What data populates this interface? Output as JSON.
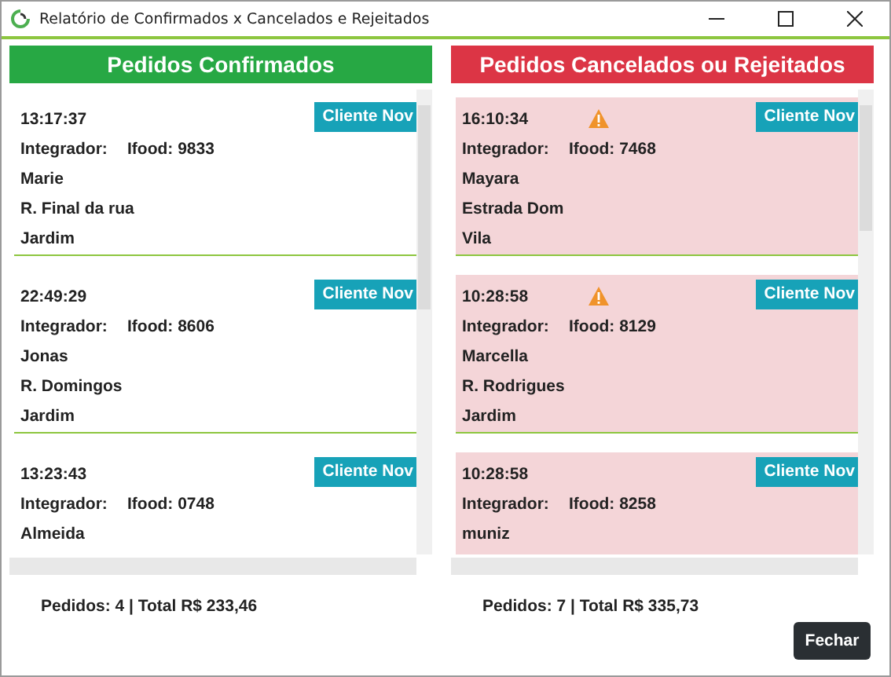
{
  "window": {
    "title": "Relatório de Confirmados x Cancelados e Rejeitados"
  },
  "panels": [
    {
      "kind": "confirmed",
      "header": "Pedidos Confirmados",
      "footer": "Pedidos: 4 | Total R$ 233,46",
      "orders": [
        {
          "time": "13:17:37",
          "warning": false,
          "button": "Cliente Nov",
          "integrator_label": "Integrador:",
          "integrator": "Ifood: 9833",
          "name": "Marie",
          "street": "R. Final da rua",
          "district": "Jardim"
        },
        {
          "time": "22:49:29",
          "warning": false,
          "button": "Cliente Nov",
          "integrator_label": "Integrador:",
          "integrator": "Ifood: 8606",
          "name": "Jonas",
          "street": "R. Domingos",
          "district": "Jardim"
        },
        {
          "time": "13:23:43",
          "warning": false,
          "button": "Cliente Nov",
          "integrator_label": "Integrador:",
          "integrator": "Ifood: 0748",
          "name": "Almeida"
        }
      ]
    },
    {
      "kind": "cancelled",
      "header": "Pedidos Cancelados ou Rejeitados",
      "footer": "Pedidos: 7 | Total R$ 335,73",
      "orders": [
        {
          "time": "16:10:34",
          "warning": true,
          "button": "Cliente Nov",
          "integrator_label": "Integrador:",
          "integrator": "Ifood: 7468",
          "name": "Mayara",
          "street": "Estrada Dom",
          "district": "Vila"
        },
        {
          "time": "10:28:58",
          "warning": true,
          "button": "Cliente Nov",
          "integrator_label": "Integrador:",
          "integrator": "Ifood: 8129",
          "name": "Marcella",
          "street": "R. Rodrigues",
          "district": "Jardim"
        },
        {
          "time": "10:28:58",
          "warning": false,
          "button": "Cliente Nov",
          "integrator_label": "Integrador:",
          "integrator": "Ifood: 8258",
          "name": "muniz"
        }
      ]
    }
  ],
  "close_button": "Fechar"
}
